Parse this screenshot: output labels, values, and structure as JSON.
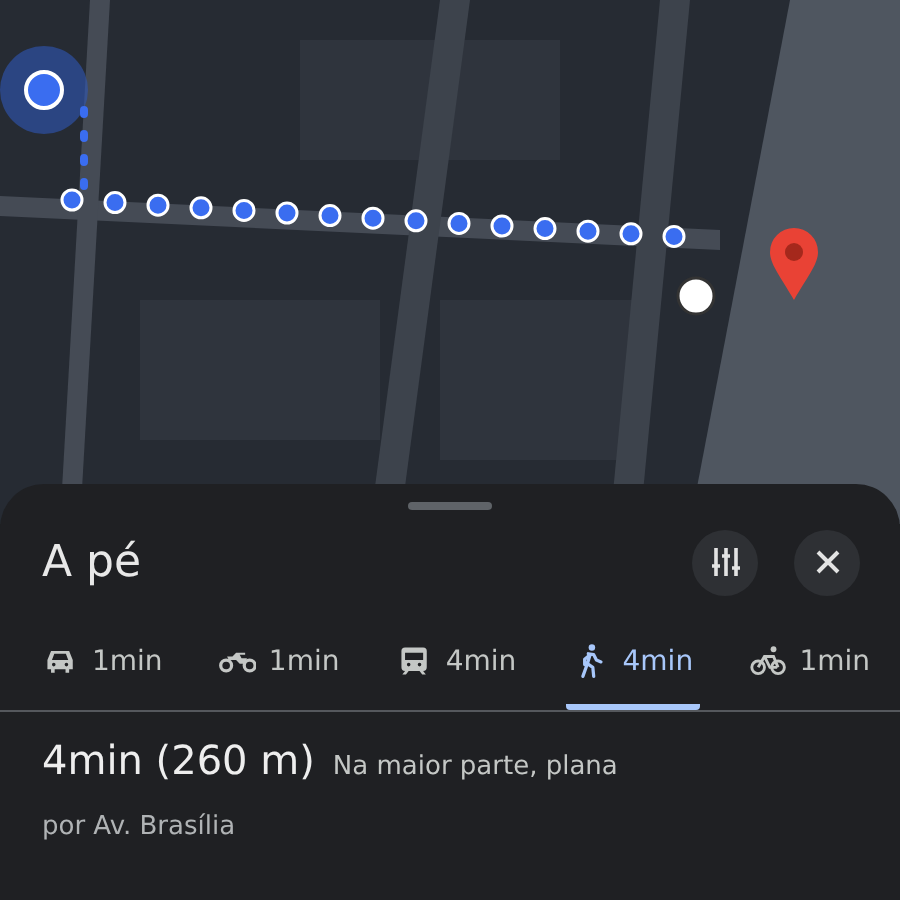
{
  "sheet": {
    "title": "A pé"
  },
  "modes": [
    {
      "kind": "car",
      "time": "1min",
      "selected": false
    },
    {
      "kind": "motorcycle",
      "time": "1min",
      "selected": false
    },
    {
      "kind": "transit",
      "time": "4min",
      "selected": false
    },
    {
      "kind": "walk",
      "time": "4min",
      "selected": true
    },
    {
      "kind": "bike",
      "time": "1min",
      "selected": false
    }
  ],
  "route": {
    "duration": "4min (260 m)",
    "terrain": "Na maior parte, plana",
    "via": "por Av. Brasília"
  }
}
